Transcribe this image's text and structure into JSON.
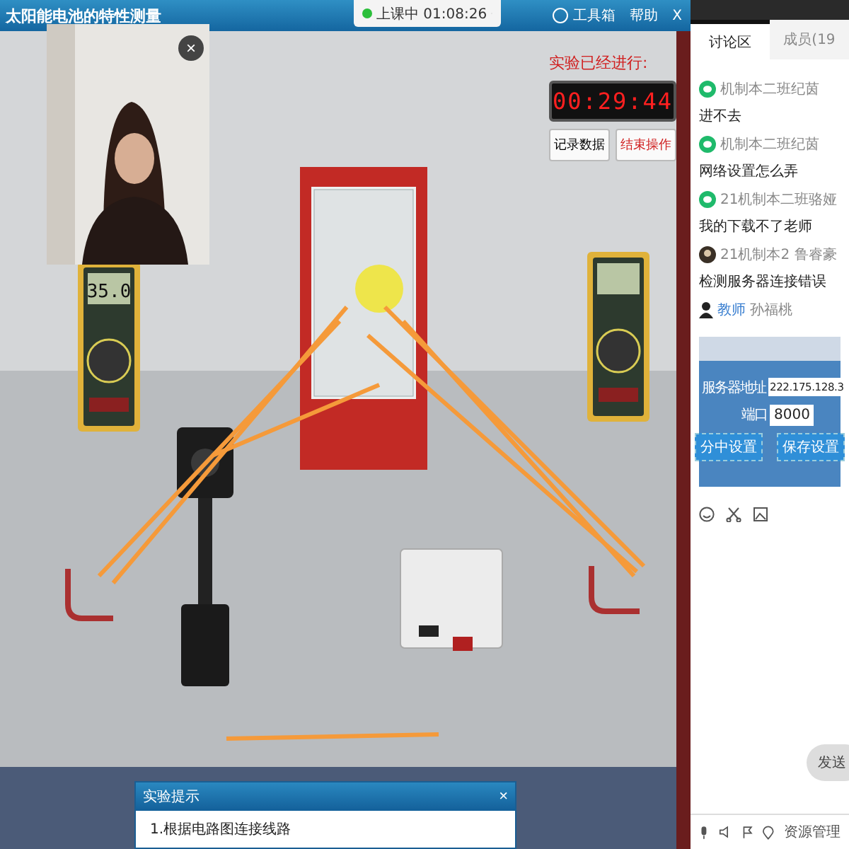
{
  "window": {
    "title": "太阳能电池的特性测量"
  },
  "class_status": {
    "label": "上课中 01:08:26"
  },
  "toolbar": [
    {
      "kind": "tool",
      "label": "工具箱"
    },
    {
      "kind": "help",
      "label": "帮助"
    },
    {
      "kind": "close",
      "label": "X"
    }
  ],
  "timer": {
    "label": "实验已经进行:",
    "time": "00:29:44",
    "buttons": [
      {
        "label": "记录数据",
        "kind": "normal"
      },
      {
        "label": "结束操作",
        "kind": "danger"
      }
    ]
  },
  "webcam": {
    "kind": "picture",
    "close": "×"
  },
  "meter_reading": "35.0",
  "chat": {
    "tabs": [
      {
        "label": "讨论区",
        "selected": true
      },
      {
        "label": "成员(19",
        "selected": false
      }
    ],
    "messages": [
      {
        "kind": "chat",
        "user": "机制本二班纪茵",
        "text": "进不去"
      },
      {
        "kind": "chat",
        "user": "机制本二班纪茵",
        "text": "网络设置怎么弄"
      },
      {
        "kind": "chat",
        "user": "21机制本二班骆娅",
        "text": "我的下载不了老师"
      },
      {
        "user": "21机制本2 鲁睿豪",
        "text": "检测服务器连接错误"
      },
      {
        "kind": "person",
        "badge": "教师",
        "user": "孙福桃"
      }
    ],
    "shared_image": {
      "address_label": "服务器地址",
      "address": "222.175.128.3",
      "port_label": "端口",
      "port": "8000",
      "buttons": [
        "分中设置",
        "保存设置"
      ]
    },
    "send": "发送",
    "resources": "资源管理"
  },
  "hint_dialog": {
    "title": "实验提示",
    "close": "×",
    "text": "1.根据电路图连接线路"
  }
}
